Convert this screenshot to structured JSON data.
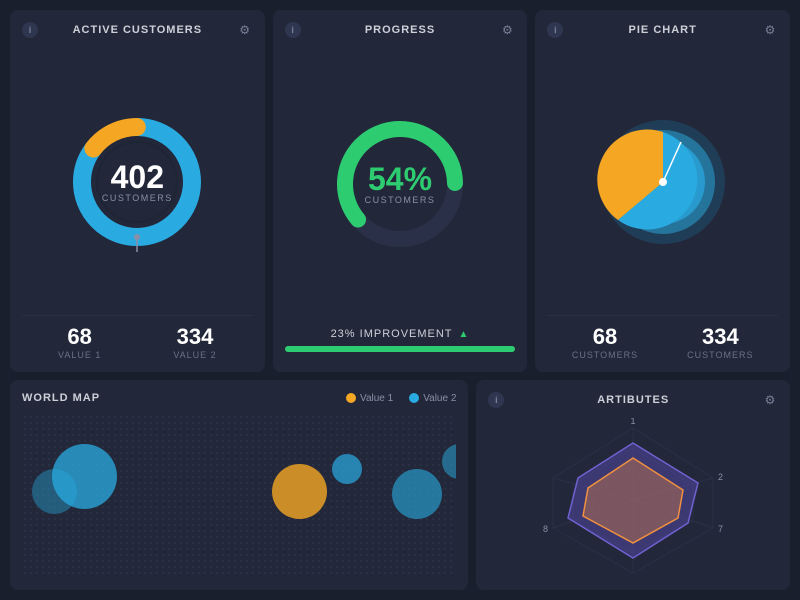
{
  "cards": {
    "active_customers": {
      "title": "ACTIVE CUSTOMERS",
      "value": "402",
      "value_label": "CUSTOMERS",
      "stat1_value": "68",
      "stat1_label": "VALUE 1",
      "stat2_value": "334",
      "stat2_label": "VALUE 2"
    },
    "progress": {
      "title": "PROGRESS",
      "value": "54%",
      "value_label": "CUSTOMERS",
      "improvement": "23% IMPROVEMENT"
    },
    "pie_chart": {
      "title": "PIE CHART",
      "stat1_value": "68",
      "stat1_label": "CUSTOMERS",
      "stat2_value": "334",
      "stat2_label": "CUSTOMERS"
    },
    "world_map": {
      "title": "WORLD MAP",
      "legend1": "Value 1",
      "legend2": "Value 2"
    },
    "attributes": {
      "title": "ARTIBUTES",
      "labels": [
        "1",
        "2",
        "7",
        "8"
      ]
    }
  },
  "icons": {
    "info": "i",
    "gear": "⚙"
  }
}
